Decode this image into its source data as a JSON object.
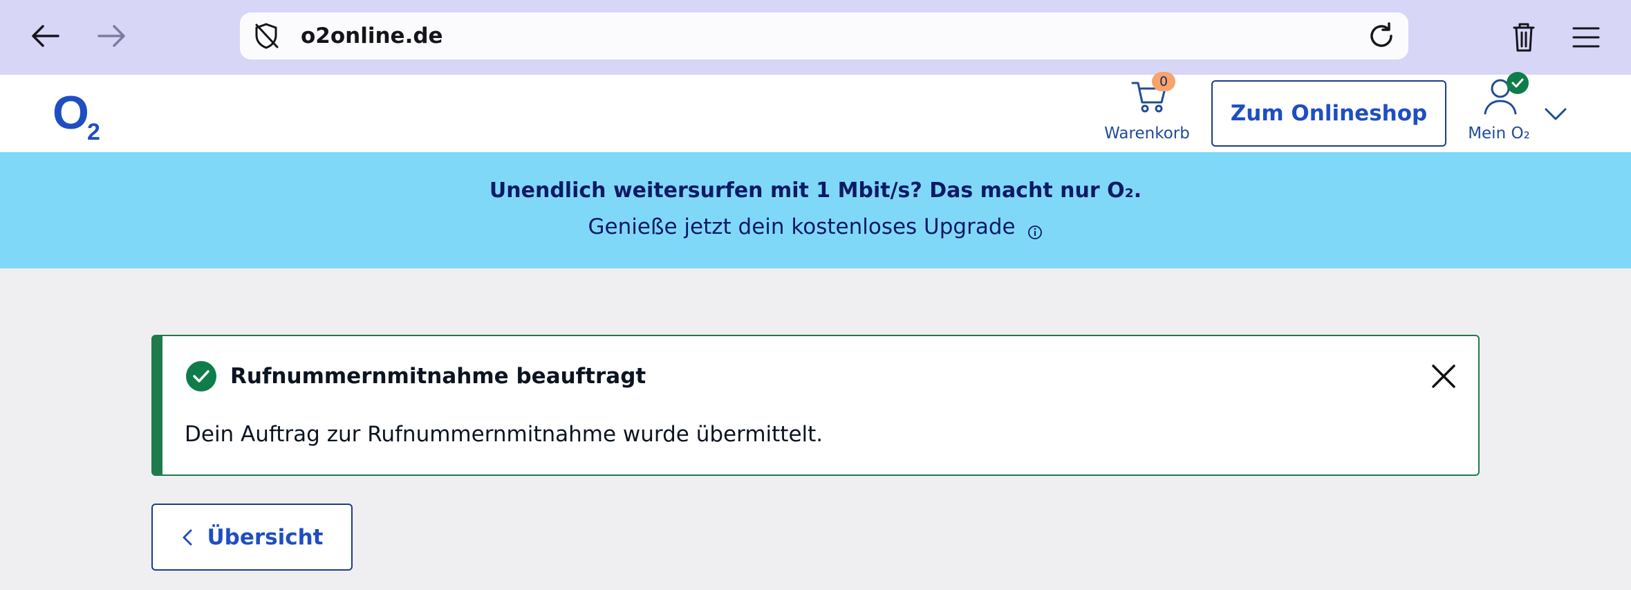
{
  "browser": {
    "url": "o2online.de",
    "icons": [
      "back-arrow-icon",
      "forward-arrow-icon",
      "tracking-shield-icon",
      "reload-icon",
      "trash-icon",
      "menu-icon"
    ]
  },
  "header": {
    "logo_text": "O",
    "logo_sub": "2",
    "cart_label": "Warenkorb",
    "cart_count": "0",
    "shop_button": "Zum Onlineshop",
    "account_label": "Mein O₂"
  },
  "promo": {
    "title": "Unendlich weitersurfen mit 1 Mbit/s? Das macht nur O₂.",
    "subtitle": "Genieße jetzt dein kostenloses Upgrade"
  },
  "notice": {
    "title": "Rufnummernmitnahme beauftragt",
    "text": "Dein Auftrag zur Rufnummernmitnahme wurde übermittelt."
  },
  "actions": {
    "back_label": "Übersicht"
  },
  "colors": {
    "browser_bar": "#d7d6f6",
    "brand_blue": "#1f4ec2",
    "promo_bg": "#80d8f9",
    "success_green": "#1f7a4c",
    "page_bg": "#efeff2"
  }
}
